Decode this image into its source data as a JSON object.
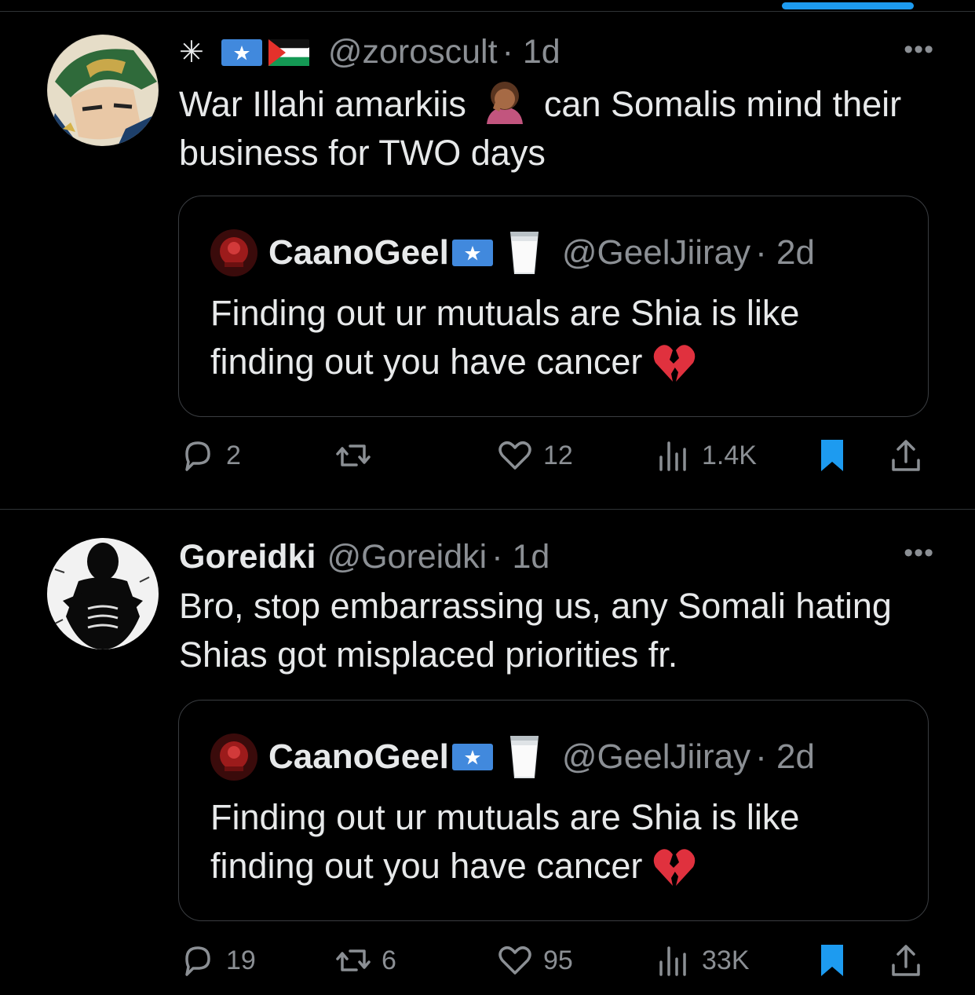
{
  "tweets": [
    {
      "handle": "@zoroscult",
      "time": "· 1d",
      "text_before": "War Illahi amarkiis",
      "text_after": " can Somalis mind their business for TWO days",
      "emoji": "facepalm-emoji",
      "quote": {
        "name": "CaanoGeel",
        "handle": "@GeelJiiray",
        "time": "· 2d",
        "text": "Finding out ur mutuals are Shia is like finding out you have cancer"
      },
      "counts": {
        "replies": "2",
        "retweets": "",
        "likes": "12",
        "views": "1.4K"
      }
    },
    {
      "name": "Goreidki",
      "handle": "@Goreidki",
      "time": "· 1d",
      "text": "Bro, stop embarrassing us, any Somali hating Shias got misplaced priorities fr.",
      "quote": {
        "name": "CaanoGeel",
        "handle": "@GeelJiiray",
        "time": "· 2d",
        "text": "Finding out ur mutuals are Shia is like finding out you have cancer"
      },
      "counts": {
        "replies": "19",
        "retweets": "6",
        "likes": "95",
        "views": "33K"
      }
    }
  ],
  "more_label": "•••",
  "star_glyph": "✳",
  "colors": {
    "accent": "#1d9bf0",
    "muted": "#8b8f94",
    "text": "#e7e9ea",
    "background": "#000000"
  }
}
